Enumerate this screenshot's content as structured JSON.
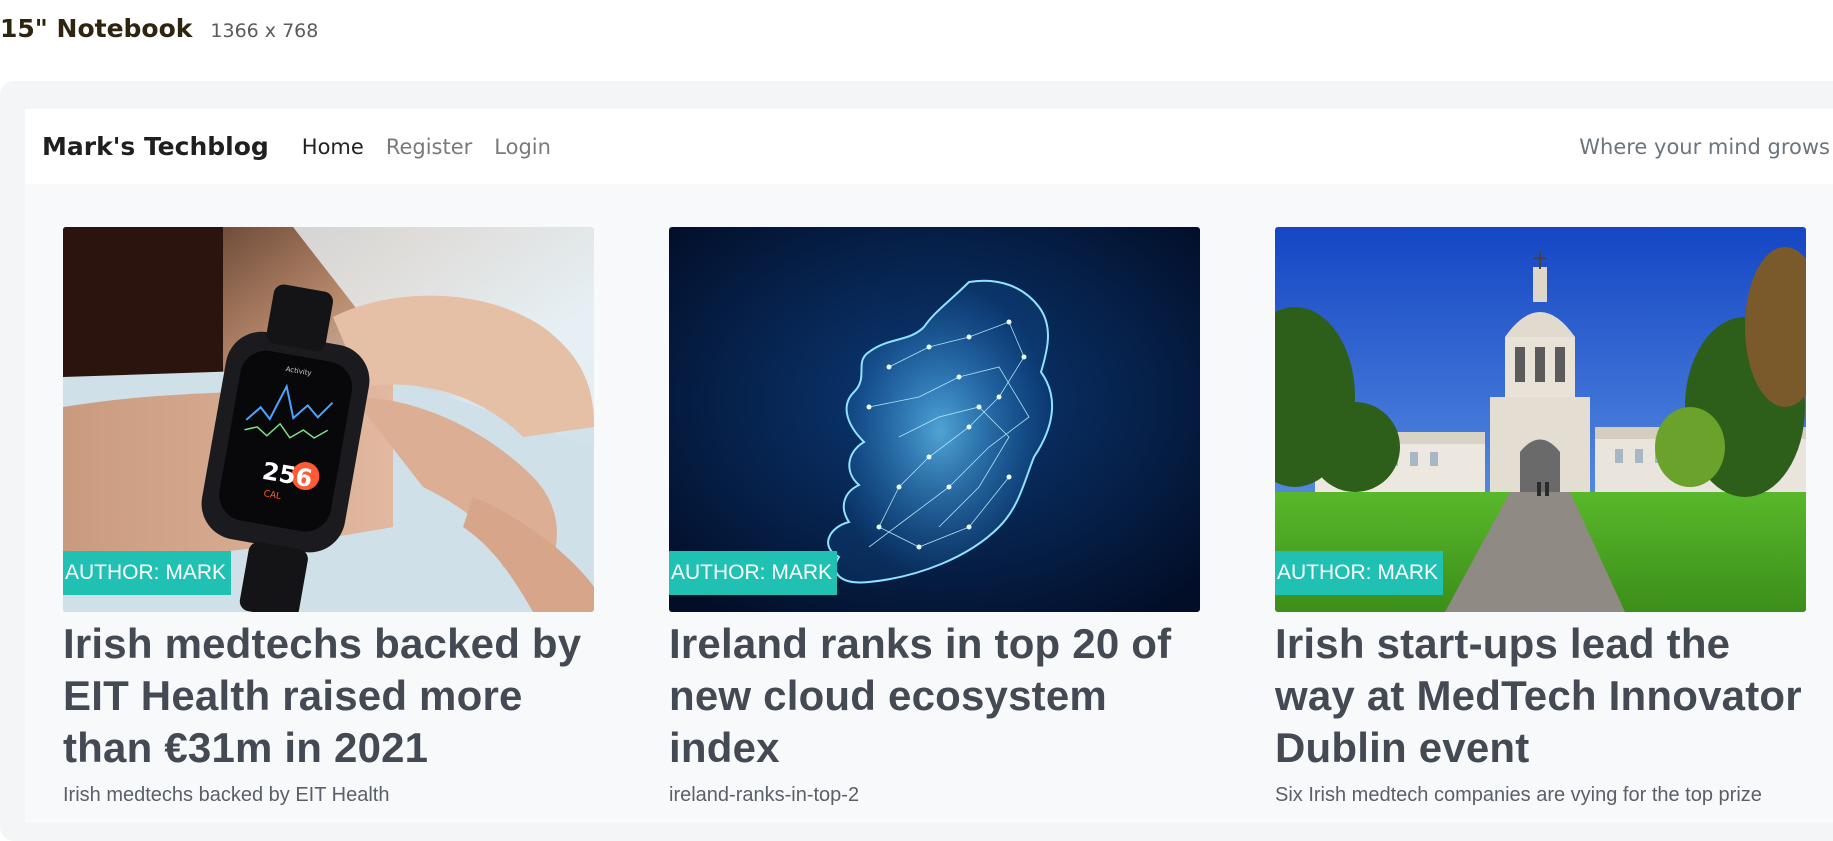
{
  "device": {
    "name": "15\" Notebook",
    "resolution": "1366 x 768"
  },
  "navbar": {
    "brand": "Mark's Techblog",
    "links": [
      {
        "label": "Home",
        "active": true
      },
      {
        "label": "Register",
        "active": false
      },
      {
        "label": "Login",
        "active": false
      }
    ],
    "tagline": "Where your mind grows"
  },
  "posts": [
    {
      "author_badge": "AUTHOR: MARK",
      "title": "Irish medtechs backed by EIT Health raised more than €31m in 2021",
      "excerpt": "Irish medtechs backed by EIT Health",
      "image_subject": "smartwatch",
      "image_text": {
        "value": "256",
        "unit": "CAL",
        "app": "Activity"
      }
    },
    {
      "author_badge": "AUTHOR: MARK",
      "title": "Ireland ranks in top 20 of new cloud ecosystem index",
      "excerpt": "ireland-ranks-in-top-2",
      "image_subject": "ireland-network-map"
    },
    {
      "author_badge": "AUTHOR: MARK",
      "title": "Irish start-ups lead the way at MedTech Innovator Dublin event",
      "excerpt": "Six Irish medtech companies are vying for the top prize",
      "image_subject": "trinity-college-campanile"
    }
  ]
}
